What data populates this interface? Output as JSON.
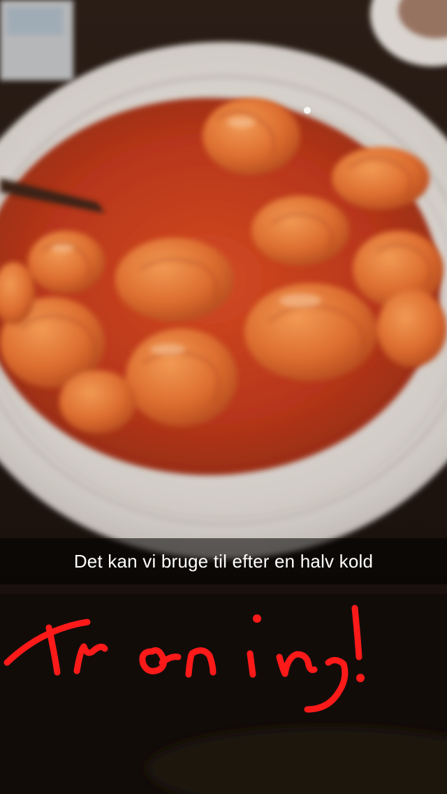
{
  "photo": {
    "subject_icon": "pasta-bowl-photo",
    "colors": {
      "sauce": "#c4401e",
      "pasta": "#e07a3a",
      "plate": "#d9d4cf",
      "table": "#1a120e"
    }
  },
  "caption": {
    "text": "Det kan vi bruge til efter en halv kold"
  },
  "drawing": {
    "handwritten_word": "Træning!",
    "color": "#ff1a1a"
  }
}
